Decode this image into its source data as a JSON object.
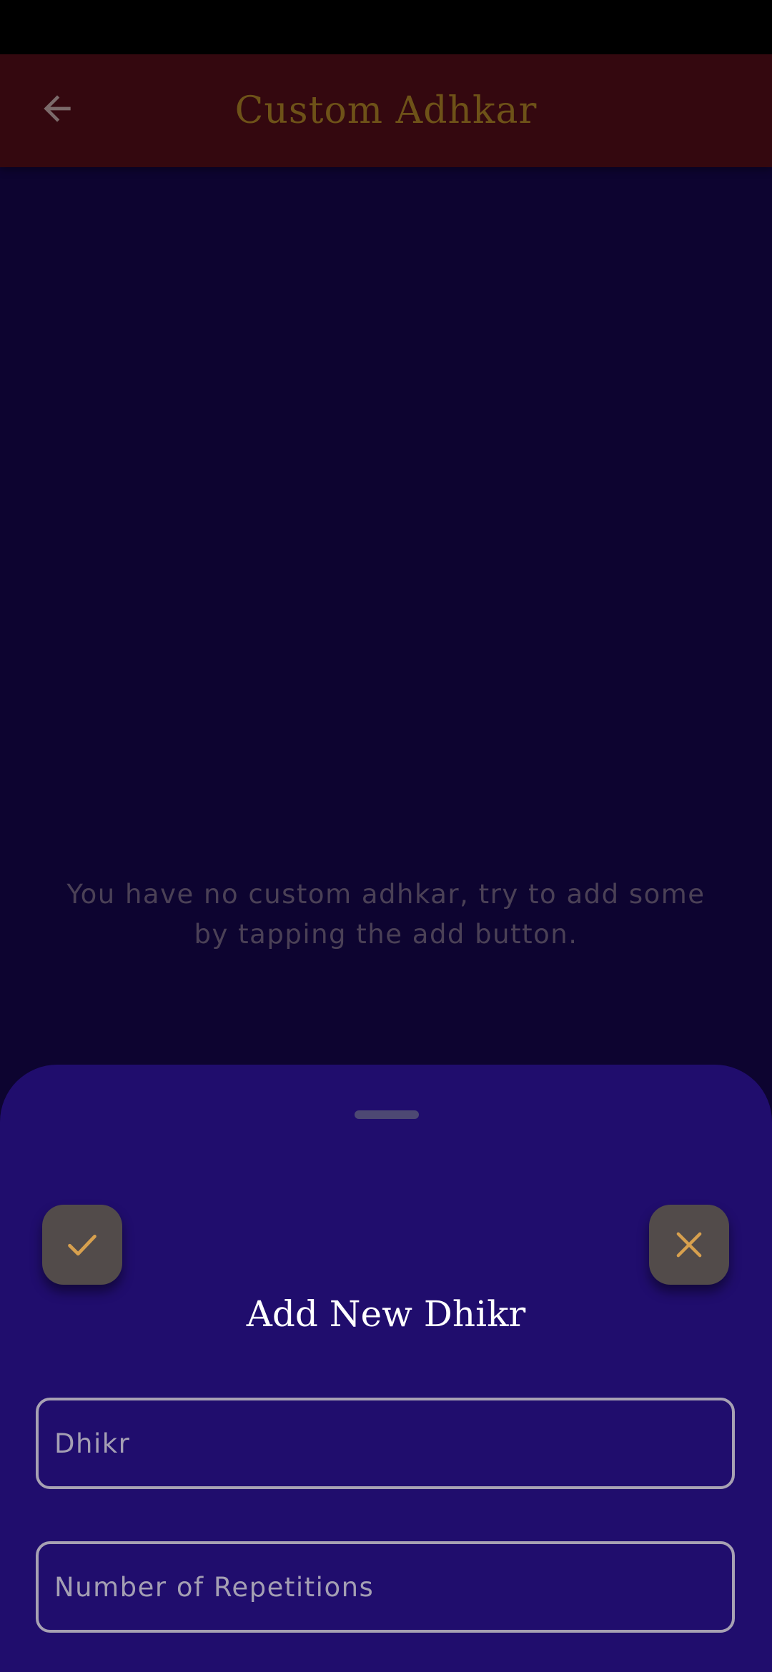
{
  "app_bar": {
    "title": "Custom Adhkar",
    "back_icon": "arrow-left-icon"
  },
  "empty_state": {
    "message": "You have no custom adhkar, try to add some by tapping the add button."
  },
  "sheet": {
    "title": "Add New Dhikr",
    "confirm_icon": "check-icon",
    "cancel_icon": "close-icon",
    "fields": {
      "dhikr": {
        "placeholder": "Dhikr",
        "value": ""
      },
      "repetitions": {
        "placeholder": "Number of Repetitions",
        "value": ""
      }
    }
  },
  "colors": {
    "background": "#0d0430",
    "app_bar": "#34080f",
    "title_gold": "#6e5218",
    "sheet": "#200d6d",
    "action_button": "#524b4a",
    "icon_gold": "#d7a04e"
  }
}
